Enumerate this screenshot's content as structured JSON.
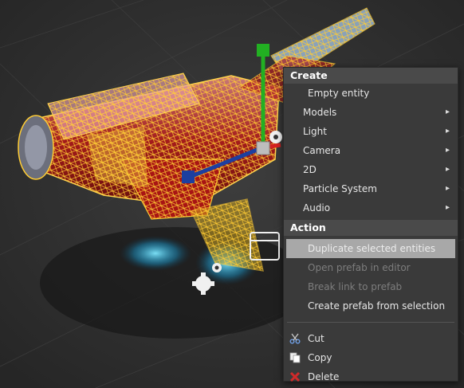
{
  "menu": {
    "create_header": "Create",
    "create_items": [
      {
        "label": "Empty entity",
        "submenu": false
      },
      {
        "label": "Models",
        "submenu": true
      },
      {
        "label": "Light",
        "submenu": true
      },
      {
        "label": "Camera",
        "submenu": true
      },
      {
        "label": "2D",
        "submenu": true
      },
      {
        "label": "Particle System",
        "submenu": true
      },
      {
        "label": "Audio",
        "submenu": true
      }
    ],
    "action_header": "Action",
    "action_items": [
      {
        "label": "Duplicate selected entities",
        "state": "highlighted"
      },
      {
        "label": "Open prefab in editor",
        "state": "disabled"
      },
      {
        "label": "Break link to prefab",
        "state": "disabled"
      },
      {
        "label": "Create prefab from selection",
        "state": "enabled"
      }
    ],
    "edit_items": [
      {
        "label": "Cut",
        "icon": "scissors-icon"
      },
      {
        "label": "Copy",
        "icon": "copy-icon"
      },
      {
        "label": "Delete",
        "icon": "delete-x-icon"
      }
    ],
    "submenu_glyph": "▸"
  },
  "colors": {
    "background": "#333333",
    "menu_bg": "#3a3a3a",
    "header_bg": "#4a4a4a",
    "highlight": "#a8a8a8",
    "wireframe": "#ffcc33",
    "gizmo_x": "#d42020",
    "gizmo_y": "#22b022",
    "gizmo_z": "#1c3fa0"
  }
}
